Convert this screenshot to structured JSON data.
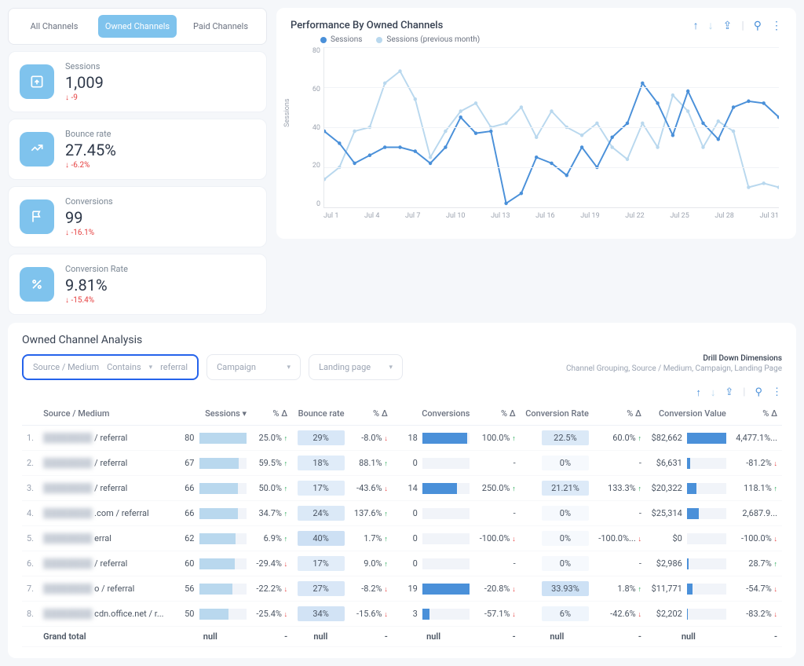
{
  "tabs": {
    "all": "All Channels",
    "owned": "Owned Channels",
    "paid": "Paid Channels"
  },
  "metrics": {
    "sessions": {
      "label": "Sessions",
      "value": "1,009",
      "delta": "-9"
    },
    "bounce": {
      "label": "Bounce rate",
      "value": "27.45%",
      "delta": "-6.2%"
    },
    "conv": {
      "label": "Conversions",
      "value": "99",
      "delta": "-16.1%"
    },
    "rate": {
      "label": "Conversion Rate",
      "value": "9.81%",
      "delta": "-15.4%"
    }
  },
  "chart": {
    "title": "Performance By Owned Channels",
    "legend": {
      "a": "Sessions",
      "b": "Sessions (previous month)"
    },
    "y_title": "Sessions",
    "y_ticks": [
      "80",
      "60",
      "40",
      "20",
      "0"
    ],
    "x_ticks": [
      "Jul 1",
      "Jul 4",
      "Jul 7",
      "Jul 10",
      "Jul 13",
      "Jul 16",
      "Jul 19",
      "Jul 22",
      "Jul 25",
      "Jul 28",
      "Jul 31"
    ]
  },
  "chart_data": {
    "type": "line",
    "title": "Performance By Owned Channels",
    "xlabel": "",
    "ylabel": "Sessions",
    "ylim": [
      0,
      80
    ],
    "x": [
      "Jul 1",
      "Jul 2",
      "Jul 3",
      "Jul 4",
      "Jul 5",
      "Jul 6",
      "Jul 7",
      "Jul 8",
      "Jul 9",
      "Jul 10",
      "Jul 11",
      "Jul 12",
      "Jul 13",
      "Jul 14",
      "Jul 15",
      "Jul 16",
      "Jul 17",
      "Jul 18",
      "Jul 19",
      "Jul 20",
      "Jul 21",
      "Jul 22",
      "Jul 23",
      "Jul 24",
      "Jul 25",
      "Jul 26",
      "Jul 27",
      "Jul 28",
      "Jul 29",
      "Jul 30",
      "Jul 31"
    ],
    "series": [
      {
        "name": "Sessions",
        "color": "#4a90d9",
        "values": [
          38,
          32,
          22,
          26,
          30,
          30,
          28,
          22,
          30,
          45,
          37,
          38,
          2,
          7,
          25,
          22,
          16,
          30,
          20,
          35,
          42,
          62,
          52,
          36,
          58,
          42,
          34,
          50,
          53,
          52,
          45
        ]
      },
      {
        "name": "Sessions (previous month)",
        "color": "#b9d8ee",
        "values": [
          14,
          20,
          38,
          40,
          62,
          68,
          54,
          25,
          38,
          48,
          52,
          40,
          42,
          50,
          35,
          48,
          40,
          36,
          42,
          30,
          24,
          42,
          30,
          56,
          48,
          30,
          43,
          38,
          10,
          12,
          10
        ]
      }
    ]
  },
  "analysis": {
    "title": "Owned Channel Analysis",
    "filter1": {
      "field": "Source / Medium",
      "op": "Contains",
      "val": "referral"
    },
    "filter2": {
      "label": "Campaign"
    },
    "filter3": {
      "label": "Landing page"
    },
    "drill": {
      "title": "Drill Down Dimensions",
      "sub": "Channel Grouping, Source / Medium, Campaign, Landing Page"
    },
    "headers": {
      "source": "Source / Medium",
      "sessions": "Sessions",
      "d1": "% Δ",
      "bounce": "Bounce rate",
      "d2": "% Δ",
      "conv": "Conversions",
      "d3": "% Δ",
      "rate": "Conversion Rate",
      "d4": "% Δ",
      "value": "Conversion Value",
      "d5": "% Δ"
    },
    "rows": [
      {
        "idx": "1.",
        "src": "/ referral",
        "sess": 80,
        "sess_pct": 100,
        "d1": "25.0%",
        "d1d": "up",
        "bounce": "29%",
        "bounce_h": 55,
        "d2": "-8.0%",
        "d2d": "down",
        "conv": "18",
        "conv_pct": 95,
        "d3": "100.0%",
        "d3d": "up",
        "rate": "22.5%",
        "rate_h": 60,
        "d4": "60.0%",
        "d4d": "up",
        "val": "$82,662",
        "val_pct": 100,
        "d5": "4,477.1%..."
      },
      {
        "idx": "2.",
        "src": "/ referral",
        "sess": 67,
        "sess_pct": 84,
        "d1": "59.5%",
        "d1d": "up",
        "bounce": "18%",
        "bounce_h": 35,
        "d2": "88.1%",
        "d2d": "up",
        "conv": "0",
        "conv_pct": 0,
        "d3": "-",
        "d3d": "",
        "rate": "0%",
        "rate_h": 0,
        "d4": "-",
        "d4d": "",
        "val": "$6,631",
        "val_pct": 8,
        "d5": "-81.2%",
        "d5d": "down"
      },
      {
        "idx": "3.",
        "src": "/ referral",
        "sess": 66,
        "sess_pct": 82,
        "d1": "50.0%",
        "d1d": "up",
        "bounce": "17%",
        "bounce_h": 32,
        "d2": "-43.6%",
        "d2d": "down",
        "conv": "14",
        "conv_pct": 74,
        "d3": "250.0%",
        "d3d": "up",
        "rate": "21.21%",
        "rate_h": 56,
        "d4": "133.3%",
        "d4d": "up",
        "val": "$20,322",
        "val_pct": 25,
        "d5": "118.1%",
        "d5d": "up"
      },
      {
        "idx": "4.",
        "src": ".com / referral",
        "sess": 66,
        "sess_pct": 82,
        "d1": "34.7%",
        "d1d": "up",
        "bounce": "24%",
        "bounce_h": 48,
        "d2": "137.6%",
        "d2d": "up",
        "conv": "0",
        "conv_pct": 0,
        "d3": "-",
        "d3d": "",
        "rate": "0%",
        "rate_h": 0,
        "d4": "-",
        "d4d": "",
        "val": "$25,314",
        "val_pct": 30,
        "d5": "2,687.9..."
      },
      {
        "idx": "5.",
        "src": "erral",
        "sess": 62,
        "sess_pct": 78,
        "d1": "6.9%",
        "d1d": "up",
        "bounce": "40%",
        "bounce_h": 80,
        "d2": "1.7%",
        "d2d": "up",
        "conv": "0",
        "conv_pct": 0,
        "d3": "-100.0%",
        "d3d": "down",
        "rate": "0%",
        "rate_h": 0,
        "d4": "-100.0%...",
        "d4d": "down",
        "val": "$0",
        "val_pct": 0,
        "d5": "-100.0%",
        "d5d": "down"
      },
      {
        "idx": "6.",
        "src": "/ referral",
        "sess": 60,
        "sess_pct": 75,
        "d1": "-29.4%",
        "d1d": "down",
        "bounce": "17%",
        "bounce_h": 32,
        "d2": "9.0%",
        "d2d": "up",
        "conv": "0",
        "conv_pct": 0,
        "d3": "-",
        "d3d": "",
        "rate": "0%",
        "rate_h": 0,
        "d4": "-",
        "d4d": "",
        "val": "$2,986",
        "val_pct": 4,
        "d5": "28.7%",
        "d5d": "up"
      },
      {
        "idx": "7.",
        "src": "o / referral",
        "sess": 56,
        "sess_pct": 70,
        "d1": "-22.2%",
        "d1d": "down",
        "bounce": "27%",
        "bounce_h": 52,
        "d2": "-8.2%",
        "d2d": "down",
        "conv": "19",
        "conv_pct": 100,
        "d3": "-20.8%",
        "d3d": "down",
        "rate": "33.93%",
        "rate_h": 90,
        "d4": "1.8%",
        "d4d": "up",
        "val": "$11,771",
        "val_pct": 14,
        "d5": "-54.7%",
        "d5d": "down"
      },
      {
        "idx": "8.",
        "src": "cdn.office.net / r...",
        "sess": 50,
        "sess_pct": 62,
        "d1": "-25.4%",
        "d1d": "down",
        "bounce": "34%",
        "bounce_h": 68,
        "d2": "-15.6%",
        "d2d": "down",
        "conv": "3",
        "conv_pct": 16,
        "d3": "-57.1%",
        "d3d": "down",
        "rate": "6%",
        "rate_h": 16,
        "d4": "-42.6%",
        "d4d": "down",
        "val": "$2,202",
        "val_pct": 3,
        "d5": "-83.2%",
        "d5d": "down"
      }
    ],
    "grand": {
      "label": "Grand total",
      "null": "null",
      "dash": "-"
    }
  },
  "colors": {
    "primary": "#4a90d9",
    "light": "#b9d8ee"
  }
}
